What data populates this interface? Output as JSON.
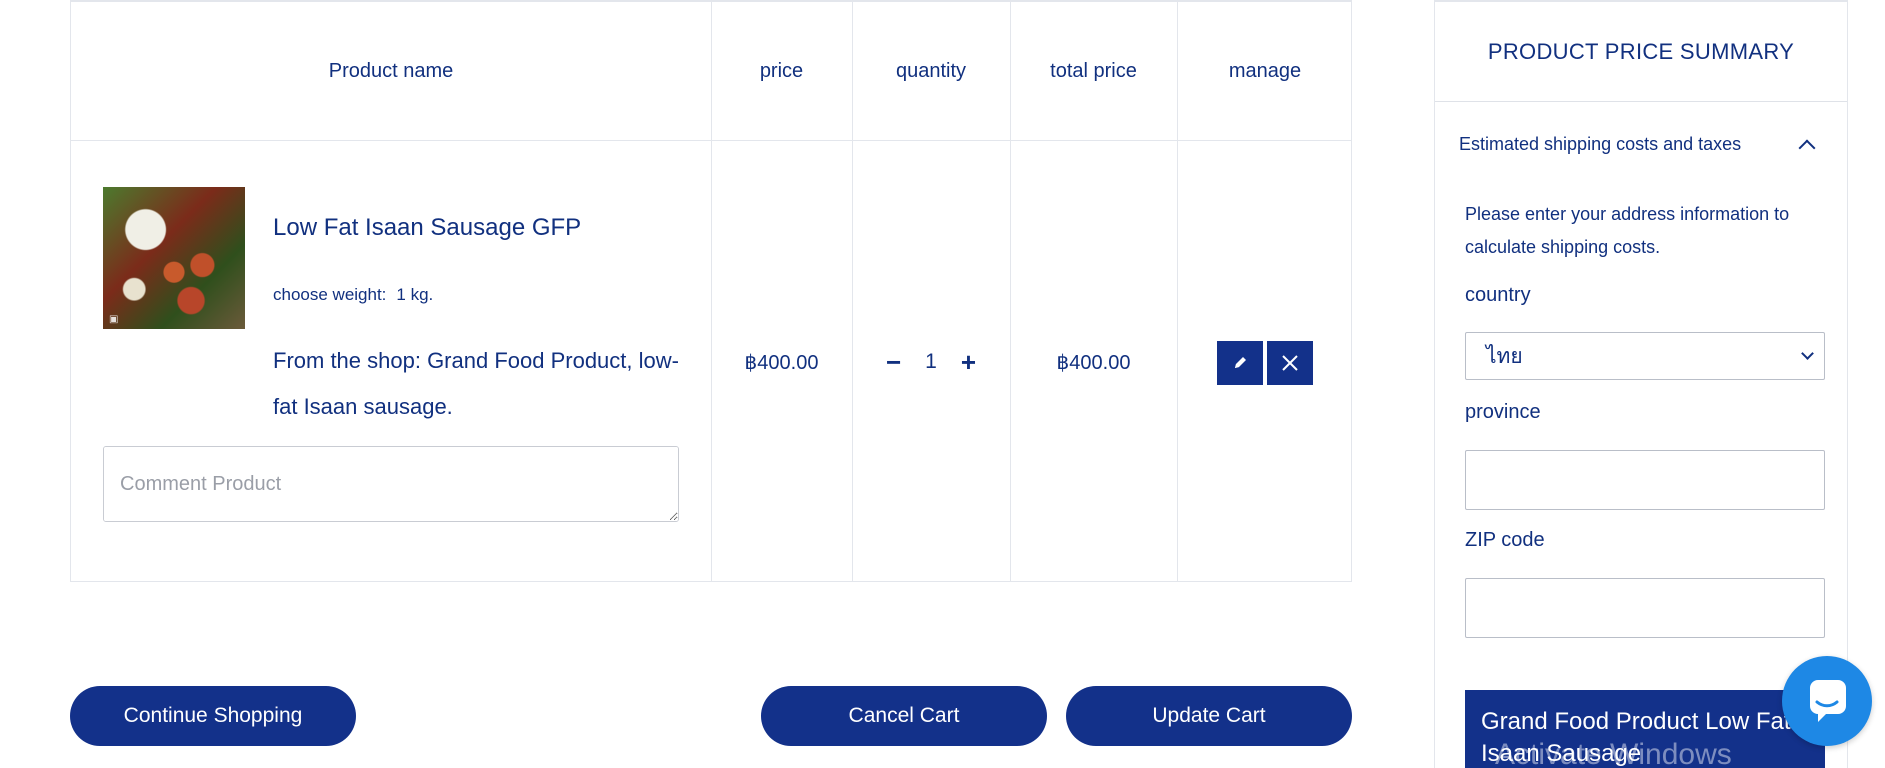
{
  "table": {
    "headers": [
      "Product name",
      "price",
      "quantity",
      "total price",
      "manage"
    ]
  },
  "item": {
    "name": "Low Fat Isaan Sausage GFP",
    "option_label": "choose weight:",
    "option_value": "1 kg.",
    "description": "From the shop: Grand Food Product, low-fat Isaan sausage.",
    "comment_placeholder": "Comment Product",
    "price": "฿400.00",
    "quantity": "1",
    "total": "฿400.00",
    "minus": "−",
    "plus": "+"
  },
  "actions": {
    "continue": "Continue Shopping",
    "cancel": "Cancel Cart",
    "update": "Update Cart"
  },
  "summary": {
    "title": "PRODUCT PRICE SUMMARY",
    "accordion_label": "Estimated shipping costs and taxes",
    "info": "Please enter your address information to calculate shipping costs.",
    "country_label": "country",
    "country_value": "ไทย",
    "province_label": "province",
    "zip_label": "ZIP code",
    "shop_title": "Grand Food Product Low Fat Isaan Sausage"
  },
  "watermark": "Activate Windows",
  "icons": {
    "edit": "pencil-icon",
    "delete": "close-icon",
    "chat": "chat-bubble-icon"
  },
  "colors": {
    "primary": "#13318a",
    "text": "#11307f",
    "chat": "#1e88e5"
  }
}
